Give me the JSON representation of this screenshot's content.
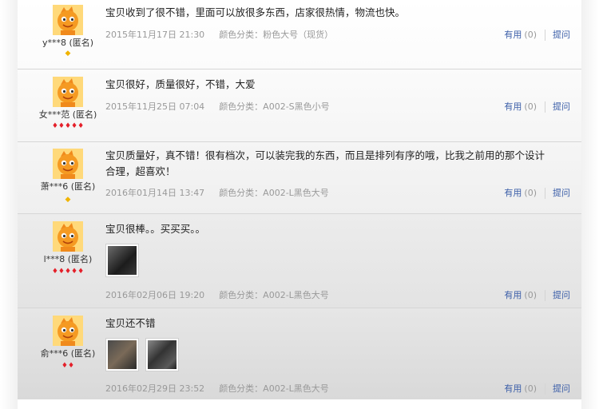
{
  "reviews": [
    {
      "username": "y***8 (匿名)",
      "rank": "diamond-1",
      "rank_diamonds": "◆",
      "rank_gems": "",
      "text": "宝贝收到了很不错，里面可以放很多东西，店家很热情，物流也快。",
      "date": "2015年11月17日 21:30",
      "spec": "颜色分类：粉色大号（现货）",
      "useful_label": "有用",
      "useful_count": "(0)",
      "ask_label": "提问",
      "images": []
    },
    {
      "username": "女***范 (匿名)",
      "rank": "heart-5",
      "rank_diamonds": "",
      "rank_gems": "♦♦♦♦♦",
      "text": "宝贝很好，质量很好，不错，大爱",
      "date": "2015年11月25日 07:04",
      "spec": "颜色分类：A002-S黑色小号",
      "useful_label": "有用",
      "useful_count": "(0)",
      "ask_label": "提问",
      "images": []
    },
    {
      "username": "萧***6 (匿名)",
      "rank": "diamond-1",
      "rank_diamonds": "◆",
      "rank_gems": "",
      "text": "宝贝质量好，真不错！很有档次，可以装完我的东西，而且是排列有序的哦，比我之前用的那个设计合理，超喜欢！",
      "date": "2016年01月14日 13:47",
      "spec": "颜色分类：A002-L黑色大号",
      "useful_label": "有用",
      "useful_count": "(0)",
      "ask_label": "提问",
      "images": []
    },
    {
      "username": "l***8 (匿名)",
      "rank": "heart-5",
      "rank_diamonds": "",
      "rank_gems": "♦♦♦♦♦",
      "text": "宝贝很棒。。买买买。。",
      "date": "2016年02月06日 19:20",
      "spec": "颜色分类：A002-L黑色大号",
      "useful_label": "有用",
      "useful_count": "(0)",
      "ask_label": "提问",
      "images": [
        "review-photo-organizer"
      ]
    },
    {
      "username": "俞***6 (匿名)",
      "rank": "heart-2",
      "rank_diamonds": "",
      "rank_gems": "♦♦",
      "text": "宝贝还不错",
      "date": "2016年02月29日 23:52",
      "spec": "颜色分类：A002-L黑色大号",
      "useful_label": "有用",
      "useful_count": "(0)",
      "ask_label": "提问",
      "images": [
        "review-photo-1",
        "review-photo-2"
      ]
    }
  ],
  "colors": {
    "link": "#3b5ea8",
    "meta": "#999999",
    "rank_heart": "#e4202a",
    "rank_diamond": "#f0b400",
    "avatar_bg": "#ffd97a"
  }
}
